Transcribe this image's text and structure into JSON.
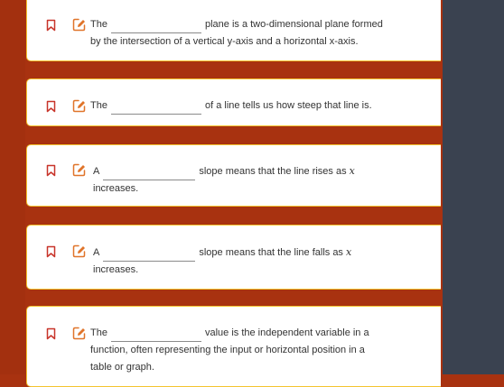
{
  "colors": {
    "background": "#a83210",
    "right_panel": "#3a4250",
    "card_border": "#f4c430",
    "icon_red": "#c8342a",
    "icon_orange": "#e0742a"
  },
  "icons": {
    "bookmark": "bookmark-icon",
    "edit": "edit-icon"
  },
  "questions": [
    {
      "prefix": "The",
      "answer": "",
      "suffix": "plane is a two-dimensional plane formed",
      "line2": "by the intersection of a vertical y-axis and a horizontal x-axis."
    },
    {
      "prefix": "The",
      "answer": "",
      "suffix": "of a line tells us how steep that line is."
    },
    {
      "prefix": "A",
      "answer": "",
      "suffix": "slope means that the line rises as",
      "variable": "x",
      "line2": "increases."
    },
    {
      "prefix": "A",
      "answer": "",
      "suffix": "slope means that the line falls as",
      "variable": "x",
      "line2": "increases."
    },
    {
      "prefix": "The",
      "answer": "",
      "suffix": "value is the independent variable in a",
      "line2": "function, often representing the input or horizontal position in a",
      "line3": "table or graph."
    }
  ]
}
